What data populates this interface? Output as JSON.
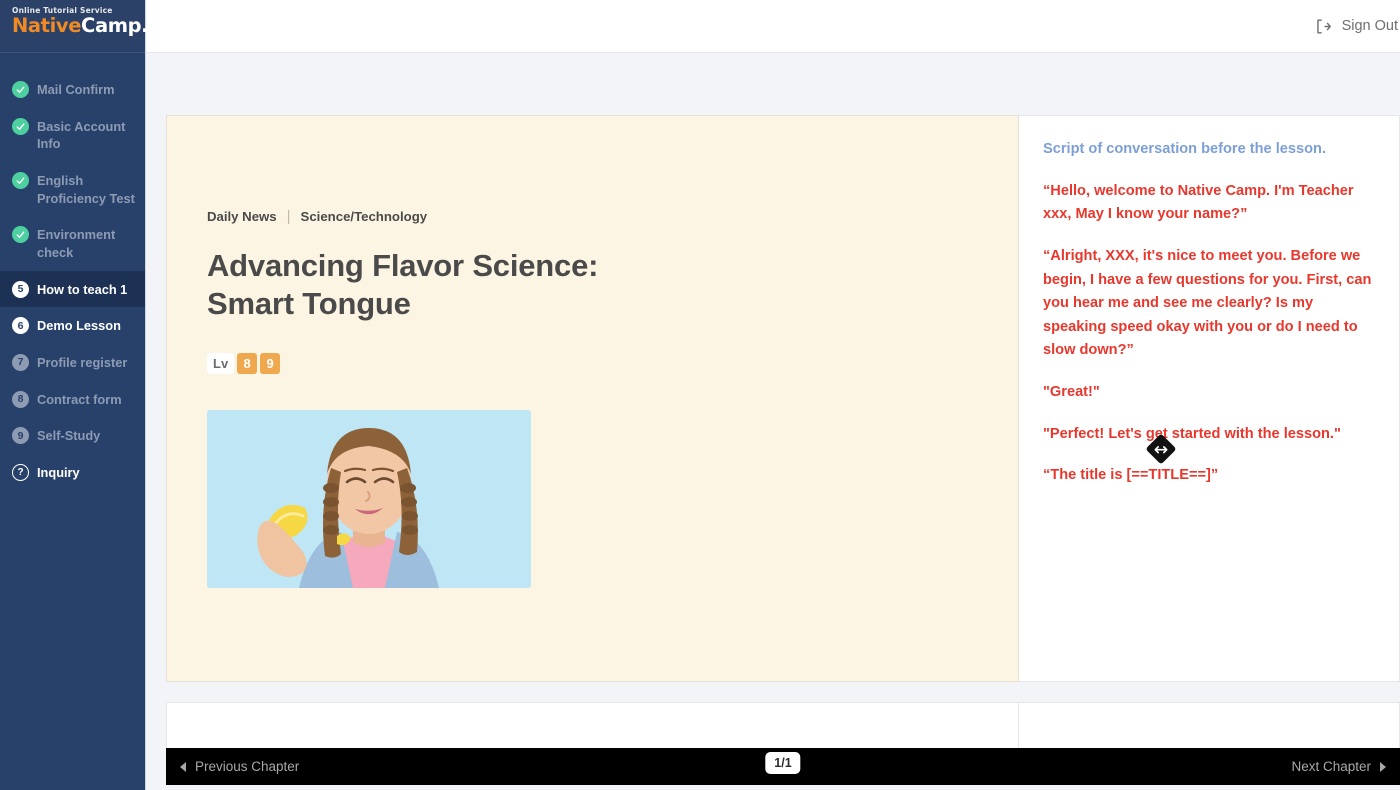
{
  "sidebar": {
    "logo": {
      "sub": "Online Tutorial Service",
      "name": "Native",
      "suffix": "Camp."
    },
    "items": [
      {
        "label": "Mail Confirm",
        "state": "done",
        "marker": "check"
      },
      {
        "label": "Basic Account Info",
        "state": "done",
        "marker": "check"
      },
      {
        "label": "English Proficiency Test",
        "state": "done",
        "marker": "check"
      },
      {
        "label": "Environment check",
        "state": "done",
        "marker": "check"
      },
      {
        "label": "How to teach 1",
        "state": "current",
        "marker": "5"
      },
      {
        "label": "Demo Lesson",
        "state": "current",
        "marker": "6"
      },
      {
        "label": "Profile register",
        "state": "pending",
        "marker": "7"
      },
      {
        "label": "Contract form",
        "state": "pending",
        "marker": "8"
      },
      {
        "label": "Self-Study",
        "state": "pending",
        "marker": "9"
      },
      {
        "label": "Inquiry",
        "state": "help",
        "marker": "?"
      }
    ]
  },
  "topbar": {
    "signout_label": "Sign Out",
    "signout_icon": "sign-out-icon"
  },
  "lesson": {
    "breadcrumb_category": "Daily News",
    "breadcrumb_separator": "|",
    "breadcrumb_topic": "Science/Technology",
    "title": "Advancing Flavor Science: Smart Tongue",
    "level_tag": "Lv",
    "level_values": [
      "8",
      "9"
    ],
    "photo_alt": "girl-tasting-lemon-photo"
  },
  "script": {
    "heading": "Script of conversation before the lesson.",
    "lines": [
      "“Hello, welcome to Native Camp. I'm Teacher xxx, May I know your name?”",
      "“Alright, XXX, it's nice to meet you. Before we begin, I have a few questions for you. First, can you hear me and see me clearly? Is my speaking speed okay with you or do I need to slow down?”",
      "\"Great!\"",
      "\"Perfect! Let's get started with the lesson.\"",
      "“The title is [==TITLE==]”"
    ]
  },
  "bottombar": {
    "prev_label": "Previous Chapter",
    "next_label": "Next Chapter",
    "page_indicator": "1/1"
  },
  "resize": {
    "name": "horizontal-resize-handle"
  },
  "colors": {
    "sidebar_bg": "#28416b",
    "sidebar_active": "#1d3155",
    "brand_orange": "#f08a24",
    "check_green": "#4ecfa0",
    "lesson_bg": "#fdf5e3",
    "script_red": "#e8382d",
    "script_blue": "#7d9fd8",
    "level_orange": "#f0a84e",
    "bottombar_bg": "#000000"
  }
}
